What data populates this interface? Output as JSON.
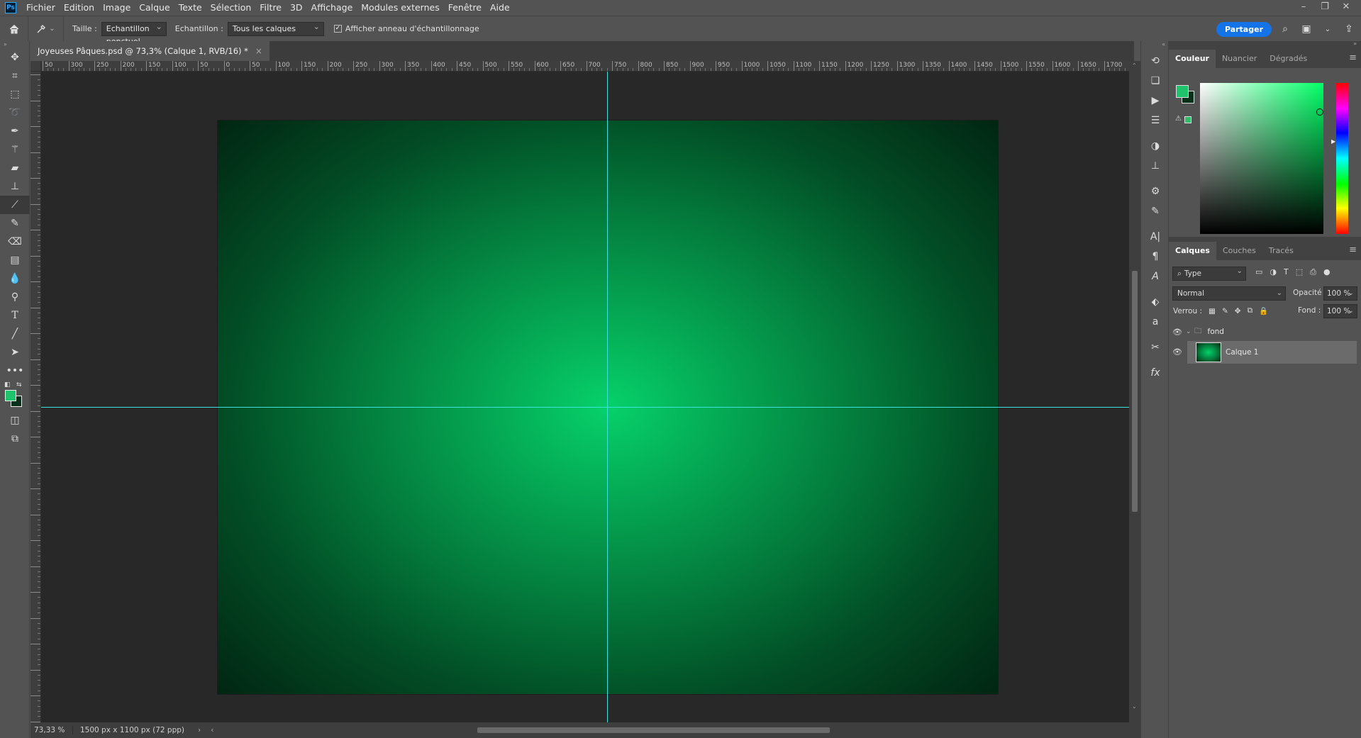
{
  "app": {
    "logo_text": "Ps"
  },
  "menu": [
    "Fichier",
    "Edition",
    "Image",
    "Calque",
    "Texte",
    "Sélection",
    "Filtre",
    "3D",
    "Affichage",
    "Modules externes",
    "Fenêtre",
    "Aide"
  ],
  "options": {
    "size_label": "Taille :",
    "size_value": "Echantillon ponctuel",
    "sample_label": "Echantillon :",
    "sample_value": "Tous les calques",
    "ring_label": "Afficher anneau d'échantillonnage",
    "ring_checked": true,
    "share_label": "Partager"
  },
  "document": {
    "tab_title": "Joyeuses Pâques.psd @ 73,3% (Calque 1, RVB/16) *",
    "zoom": "73,33 %",
    "info": "1500 px x 1100 px (72 ppp)"
  },
  "ruler_top_labels": [
    "50",
    "300",
    "250",
    "200",
    "150",
    "100",
    "50",
    "0",
    "50",
    "100",
    "150",
    "200",
    "250",
    "300",
    "350",
    "400",
    "450",
    "500",
    "550",
    "600",
    "650",
    "700",
    "750",
    "800",
    "850",
    "900",
    "950",
    "1000",
    "1050",
    "1100",
    "1150",
    "1200",
    "1250",
    "1300",
    "1350",
    "1400",
    "1450",
    "1500",
    "1550",
    "1600",
    "1650",
    "1700"
  ],
  "colors": {
    "foreground": "#1fc36b",
    "background": "#05301a",
    "accent": "#1473e6",
    "guide": "#3fe0e0"
  },
  "color_panel": {
    "tabs": [
      "Couleur",
      "Nuancier",
      "Dégradés"
    ],
    "active_tab": "Couleur"
  },
  "layers_panel": {
    "tabs": [
      "Calques",
      "Couches",
      "Tracés"
    ],
    "active_tab": "Calques",
    "filter": "Type",
    "blend_mode": "Normal",
    "opacity_label": "Opacité :",
    "opacity_value": "100 %",
    "lock_label": "Verrou :",
    "fill_label": "Fond :",
    "fill_value": "100 %",
    "group_name": "fond",
    "layer_name": "Calque 1"
  }
}
